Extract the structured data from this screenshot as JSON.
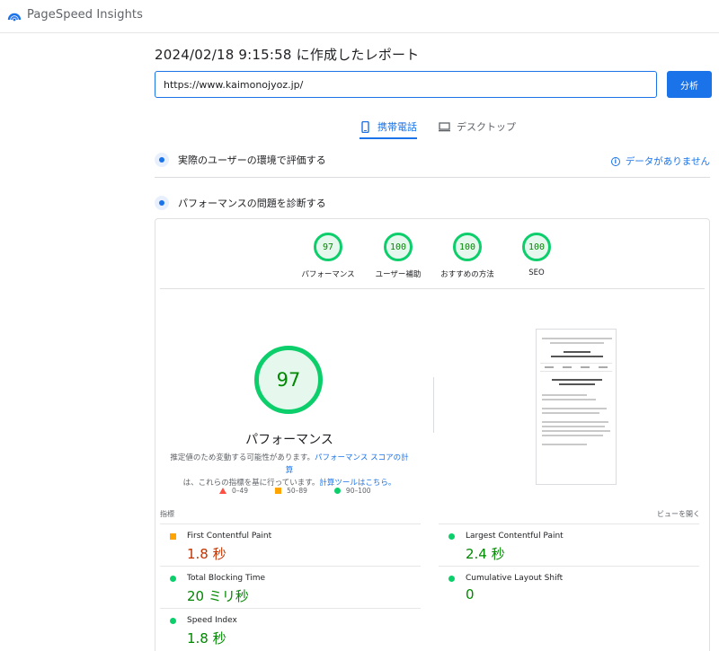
{
  "app": {
    "name": "PageSpeed Insights"
  },
  "report": {
    "title": "2024/02/18 9:15:58 に作成したレポート"
  },
  "search": {
    "value": "https://www.kaimonojyoz.jp/",
    "analyze_label": "分析"
  },
  "tabs": [
    {
      "label": "携帯電話",
      "active": true,
      "icon": "mobile-icon"
    },
    {
      "label": "デスクトップ",
      "active": false,
      "icon": "desktop-icon"
    }
  ],
  "field_data": {
    "title": "実際のユーザーの環境で評価する",
    "status": "データがありません"
  },
  "lab": {
    "title": "パフォーマンスの問題を診断する"
  },
  "categories": [
    {
      "score": "97",
      "label": "パフォーマンス"
    },
    {
      "score": "100",
      "label": "ユーザー補助"
    },
    {
      "score": "100",
      "label": "おすすめの方法"
    },
    {
      "score": "100",
      "label": "SEO"
    }
  ],
  "performance": {
    "score": "97",
    "title": "パフォーマンス",
    "desc_part1": "推定値のため変動する可能性があります。",
    "desc_link1": "パフォーマンス スコアの計算",
    "desc_part2": "は、これらの指標を基に行っています。",
    "desc_link2": "計算ツールはこちら。"
  },
  "legend": {
    "poor": "0–49",
    "average": "50–89",
    "good": "90–100"
  },
  "metrics_header": {
    "label": "指標",
    "expand": "ビューを開く"
  },
  "metrics": [
    {
      "name": "First Contentful Paint",
      "value": "1.8 秒",
      "rating": "average"
    },
    {
      "name": "Largest Contentful Paint",
      "value": "2.4 秒",
      "rating": "good"
    },
    {
      "name": "Total Blocking Time",
      "value": "20 ミリ秒",
      "rating": "good"
    },
    {
      "name": "Cumulative Layout Shift",
      "value": "0",
      "rating": "good"
    },
    {
      "name": "Speed Index",
      "value": "1.8 秒",
      "rating": "good"
    }
  ],
  "colors": {
    "accent": "#1a73e8",
    "good": "#0cce6b",
    "average": "#ffa400",
    "poor": "#ff4e42"
  }
}
